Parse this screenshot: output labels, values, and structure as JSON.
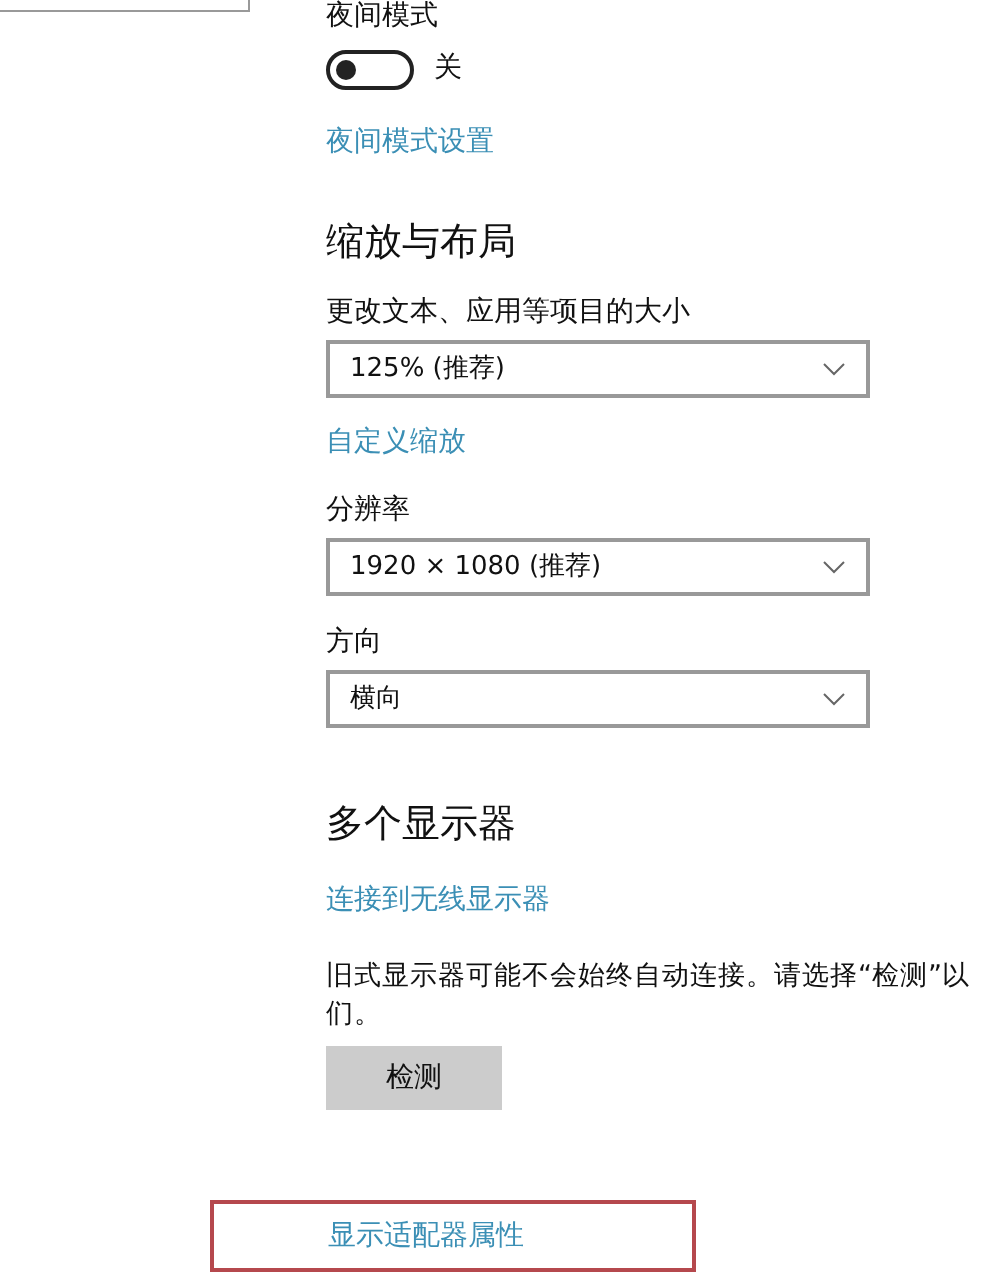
{
  "night_mode": {
    "label": "夜间模式",
    "toggle": {
      "on": false,
      "state_label": "关"
    },
    "link": "夜间模式设置"
  },
  "scale_layout": {
    "heading": "缩放与布局",
    "settings": [
      {
        "label": "更改文本、应用等项目的大小",
        "value": "125% (推荐)",
        "link": "自定义缩放"
      },
      {
        "label": "分辨率",
        "value": "1920 × 1080 (推荐)"
      },
      {
        "label": "方向",
        "value": "横向"
      }
    ]
  },
  "multiple_displays": {
    "heading": "多个显示器",
    "link": "连接到无线显示器",
    "note_lines": [
      "旧式显示器可能不会始终自动连接。请选择“检测”以",
      "们。"
    ],
    "button": "检测"
  },
  "adapter_link": {
    "text": "显示适配器属性",
    "highlighted": true
  }
}
